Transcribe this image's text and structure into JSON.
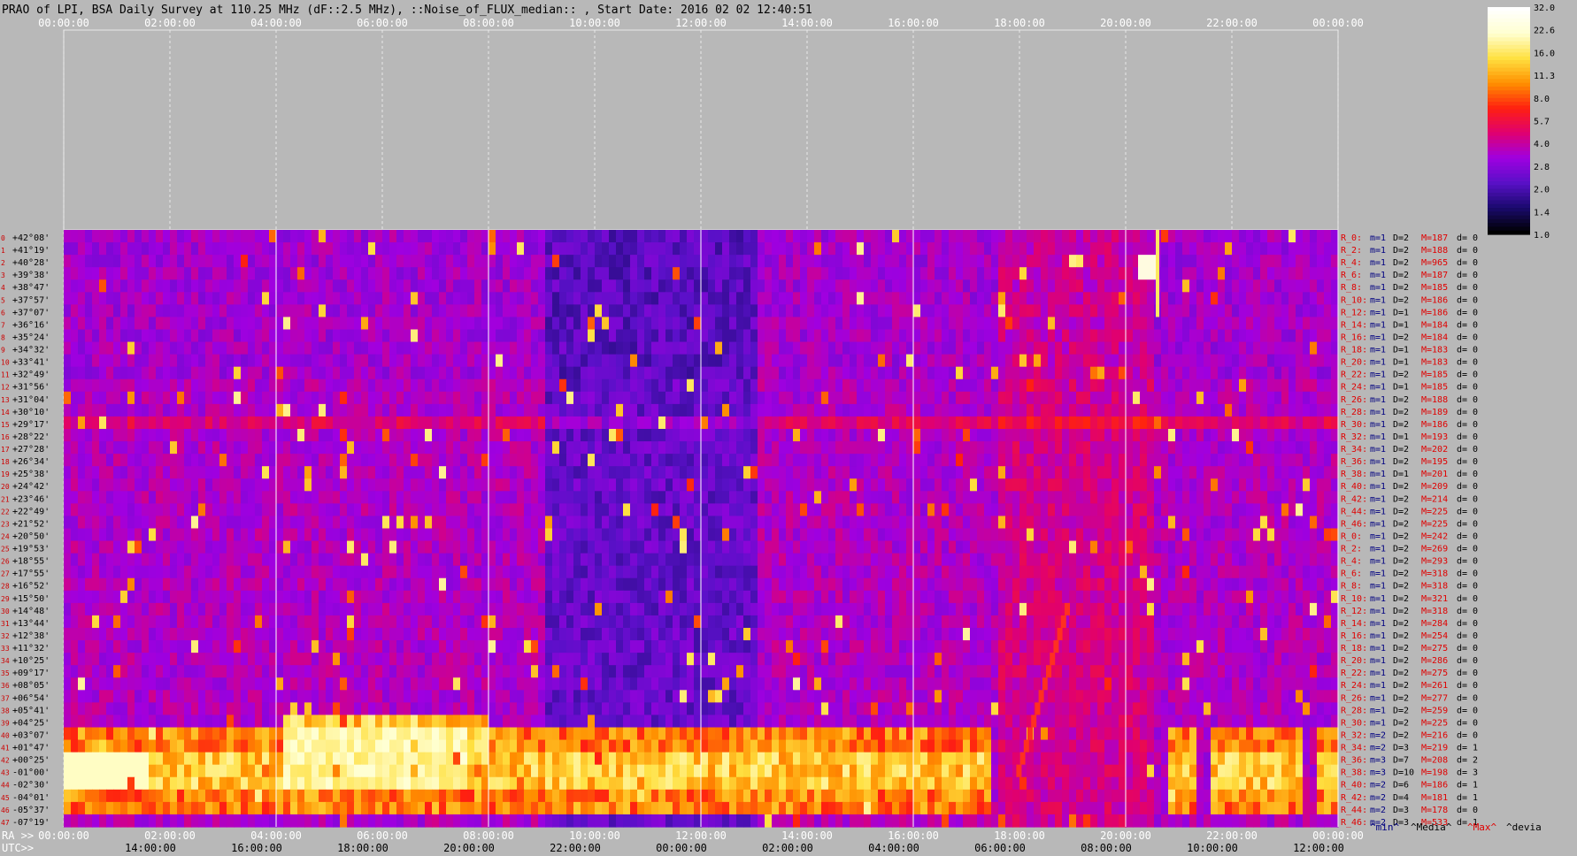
{
  "chart_data": {
    "type": "heatmap",
    "title": "PRAO of LPI, BSA Daily Survey at 110.25 MHz (dF::2.5 MHz), ::Noise_of_FLUX_median:: , Start Date: 2016 02 02 12:40:51",
    "top_time_ticks": [
      "00:00:00",
      "02:00:00",
      "04:00:00",
      "06:00:00",
      "08:00:00",
      "10:00:00",
      "12:00:00",
      "14:00:00",
      "16:00:00",
      "18:00:00",
      "20:00:00",
      "22:00:00",
      "00:00:00"
    ],
    "ra_axis_label": "RA >>",
    "ra_ticks": [
      "00:00:00",
      "02:00:00",
      "04:00:00",
      "06:00:00",
      "08:00:00",
      "10:00:00",
      "12:00:00",
      "14:00:00",
      "16:00:00",
      "18:00:00",
      "20:00:00",
      "22:00:00",
      "00:00:00"
    ],
    "utc_axis_label": "UTC>>",
    "utc_ticks": [
      "14:00:00",
      "16:00:00",
      "18:00:00",
      "20:00:00",
      "22:00:00",
      "00:00:00",
      "02:00:00",
      "04:00:00",
      "06:00:00",
      "08:00:00",
      "10:00:00",
      "12:00:00"
    ],
    "declination_labels": [
      "+42°08'",
      "+41°19'",
      "+40°28'",
      "+39°38'",
      "+38°47'",
      "+37°57'",
      "+37°07'",
      "+36°16'",
      "+35°24'",
      "+34°32'",
      "+33°41'",
      "+32°49'",
      "+31°56'",
      "+31°04'",
      "+30°10'",
      "+29°17'",
      "+28°22'",
      "+27°28'",
      "+26°34'",
      "+25°38'",
      "+24°42'",
      "+23°46'",
      "+22°49'",
      "+21°52'",
      "+20°50'",
      "+19°53'",
      "+18°55'",
      "+17°55'",
      "+16°52'",
      "+15°50'",
      "+14°48'",
      "+13°44'",
      "+12°38'",
      "+11°32'",
      "+10°25'",
      "+09°17'",
      "+08°05'",
      "+06°54'",
      "+05°41'",
      "+04°25'",
      "+03°07'",
      "+01°47'",
      "+00°25'",
      "-01°00'",
      "-02°30'",
      "-04°01'",
      "-05°37'",
      "-07°19'"
    ],
    "row_numbers": [
      "0",
      "1",
      "2",
      "3",
      "4",
      "5",
      "6",
      "7",
      "8",
      "9",
      "10",
      "11",
      "12",
      "13",
      "14",
      "15",
      "16",
      "17",
      "18",
      "19",
      "20",
      "21",
      "22",
      "23",
      "24",
      "25",
      "26",
      "27",
      "28",
      "29",
      "30",
      "31",
      "32",
      "33",
      "34",
      "35",
      "36",
      "37",
      "38",
      "39",
      "40",
      "41",
      "42",
      "43",
      "44",
      "45",
      "46",
      "47"
    ],
    "row_stats": [
      {
        "r": "R_0:",
        "m": "m=1",
        "d": "D=2",
        "M": "M=187",
        "dv": "d= 0"
      },
      {
        "r": "R_2:",
        "m": "m=1",
        "d": "D=2",
        "M": "M=188",
        "dv": "d= 0"
      },
      {
        "r": "R_4:",
        "m": "m=1",
        "d": "D=2",
        "M": "M=965",
        "dv": "d= 0"
      },
      {
        "r": "R_6:",
        "m": "m=1",
        "d": "D=2",
        "M": "M=187",
        "dv": "d= 0"
      },
      {
        "r": "R_8:",
        "m": "m=1",
        "d": "D=2",
        "M": "M=185",
        "dv": "d= 0"
      },
      {
        "r": "R_10:",
        "m": "m=1",
        "d": "D=2",
        "M": "M=186",
        "dv": "d= 0"
      },
      {
        "r": "R_12:",
        "m": "m=1",
        "d": "D=1",
        "M": "M=186",
        "dv": "d= 0"
      },
      {
        "r": "R_14:",
        "m": "m=1",
        "d": "D=1",
        "M": "M=184",
        "dv": "d= 0"
      },
      {
        "r": "R_16:",
        "m": "m=1",
        "d": "D=2",
        "M": "M=184",
        "dv": "d= 0"
      },
      {
        "r": "R_18:",
        "m": "m=1",
        "d": "D=1",
        "M": "M=183",
        "dv": "d= 0"
      },
      {
        "r": "R_20:",
        "m": "m=1",
        "d": "D=1",
        "M": "M=183",
        "dv": "d= 0"
      },
      {
        "r": "R_22:",
        "m": "m=1",
        "d": "D=2",
        "M": "M=185",
        "dv": "d= 0"
      },
      {
        "r": "R_24:",
        "m": "m=1",
        "d": "D=1",
        "M": "M=185",
        "dv": "d= 0"
      },
      {
        "r": "R_26:",
        "m": "m=1",
        "d": "D=2",
        "M": "M=188",
        "dv": "d= 0"
      },
      {
        "r": "R_28:",
        "m": "m=1",
        "d": "D=2",
        "M": "M=189",
        "dv": "d= 0"
      },
      {
        "r": "R_30:",
        "m": "m=1",
        "d": "D=2",
        "M": "M=186",
        "dv": "d= 0"
      },
      {
        "r": "R_32:",
        "m": "m=1",
        "d": "D=1",
        "M": "M=193",
        "dv": "d= 0"
      },
      {
        "r": "R_34:",
        "m": "m=1",
        "d": "D=2",
        "M": "M=202",
        "dv": "d= 0"
      },
      {
        "r": "R_36:",
        "m": "m=1",
        "d": "D=2",
        "M": "M=195",
        "dv": "d= 0"
      },
      {
        "r": "R_38:",
        "m": "m=1",
        "d": "D=1",
        "M": "M=201",
        "dv": "d= 0"
      },
      {
        "r": "R_40:",
        "m": "m=1",
        "d": "D=2",
        "M": "M=209",
        "dv": "d= 0"
      },
      {
        "r": "R_42:",
        "m": "m=1",
        "d": "D=2",
        "M": "M=214",
        "dv": "d= 0"
      },
      {
        "r": "R_44:",
        "m": "m=1",
        "d": "D=2",
        "M": "M=225",
        "dv": "d= 0"
      },
      {
        "r": "R_46:",
        "m": "m=1",
        "d": "D=2",
        "M": "M=225",
        "dv": "d= 0"
      },
      {
        "r": "R_0:",
        "m": "m=1",
        "d": "D=2",
        "M": "M=242",
        "dv": "d= 0"
      },
      {
        "r": "R_2:",
        "m": "m=1",
        "d": "D=2",
        "M": "M=269",
        "dv": "d= 0"
      },
      {
        "r": "R_4:",
        "m": "m=1",
        "d": "D=2",
        "M": "M=293",
        "dv": "d= 0"
      },
      {
        "r": "R_6:",
        "m": "m=1",
        "d": "D=2",
        "M": "M=318",
        "dv": "d= 0"
      },
      {
        "r": "R_8:",
        "m": "m=1",
        "d": "D=2",
        "M": "M=318",
        "dv": "d= 0"
      },
      {
        "r": "R_10:",
        "m": "m=1",
        "d": "D=2",
        "M": "M=321",
        "dv": "d= 0"
      },
      {
        "r": "R_12:",
        "m": "m=1",
        "d": "D=2",
        "M": "M=318",
        "dv": "d= 0"
      },
      {
        "r": "R_14:",
        "m": "m=1",
        "d": "D=2",
        "M": "M=284",
        "dv": "d= 0"
      },
      {
        "r": "R_16:",
        "m": "m=1",
        "d": "D=2",
        "M": "M=254",
        "dv": "d= 0"
      },
      {
        "r": "R_18:",
        "m": "m=1",
        "d": "D=2",
        "M": "M=275",
        "dv": "d= 0"
      },
      {
        "r": "R_20:",
        "m": "m=1",
        "d": "D=2",
        "M": "M=286",
        "dv": "d= 0"
      },
      {
        "r": "R_22:",
        "m": "m=1",
        "d": "D=2",
        "M": "M=275",
        "dv": "d= 0"
      },
      {
        "r": "R_24:",
        "m": "m=1",
        "d": "D=2",
        "M": "M=261",
        "dv": "d= 0"
      },
      {
        "r": "R_26:",
        "m": "m=1",
        "d": "D=2",
        "M": "M=277",
        "dv": "d= 0"
      },
      {
        "r": "R_28:",
        "m": "m=1",
        "d": "D=2",
        "M": "M=259",
        "dv": "d= 0"
      },
      {
        "r": "R_30:",
        "m": "m=1",
        "d": "D=2",
        "M": "M=225",
        "dv": "d= 0"
      },
      {
        "r": "R_32:",
        "m": "m=2",
        "d": "D=2",
        "M": "M=216",
        "dv": "d= 0"
      },
      {
        "r": "R_34:",
        "m": "m=2",
        "d": "D=3",
        "M": "M=219",
        "dv": "d= 1"
      },
      {
        "r": "R_36:",
        "m": "m=3",
        "d": "D=7",
        "M": "M=208",
        "dv": "d= 2"
      },
      {
        "r": "R_38:",
        "m": "m=3",
        "d": "D=10",
        "M": "M=198",
        "dv": "d= 3"
      },
      {
        "r": "R_40:",
        "m": "m=2",
        "d": "D=6",
        "M": "M=186",
        "dv": "d= 1"
      },
      {
        "r": "R_42:",
        "m": "m=2",
        "d": "D=4",
        "M": "M=181",
        "dv": "d= 1"
      },
      {
        "r": "R_44:",
        "m": "m=2",
        "d": "D=3",
        "M": "M=178",
        "dv": "d= 0"
      },
      {
        "r": "R_46:",
        "m": "m=2",
        "d": "D=3",
        "M": "M=533",
        "dv": "d= 1"
      }
    ],
    "stat_legend": {
      "min": "^min^",
      "media": "^Media^",
      "max": "^Max^",
      "devia": "^devia"
    },
    "colorbar": {
      "ticks": [
        "32.0",
        "22.6",
        "16.0",
        "11.3",
        "8.0",
        "5.7",
        "4.0",
        "2.8",
        "2.0",
        "1.4",
        "1.0"
      ],
      "range": [
        1.0,
        32.0
      ],
      "scale": "log",
      "colormap": [
        "#000000",
        "#1a0a6e",
        "#5a10c8",
        "#a000e0",
        "#e00070",
        "#ff2010",
        "#ff9000",
        "#ffe040",
        "#ffffd0",
        "#ffffff"
      ]
    },
    "colors": {
      "background": "#b8b8b8",
      "tick_text": "#ffffff",
      "dec_text": "#000000",
      "row_num_text": "#cc0000",
      "stat_red": "#e00000",
      "stat_blue": "#000080",
      "stat_black": "#000000"
    }
  }
}
